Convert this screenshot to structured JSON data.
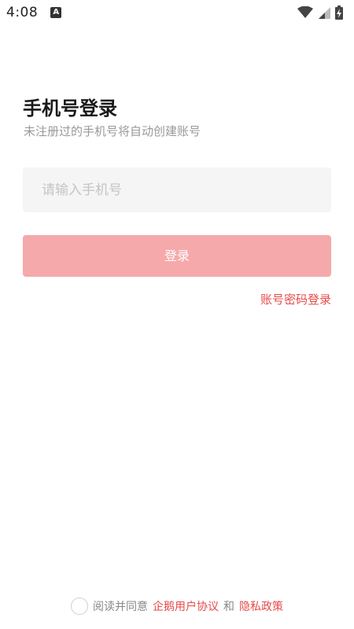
{
  "status_bar": {
    "time": "4:08",
    "notification_letter": "A",
    "icons": [
      "wifi-icon",
      "cellular-signal-icon",
      "battery-charging-icon"
    ]
  },
  "login": {
    "title": "手机号登录",
    "subtitle": "未注册过的手机号将自动创建账号",
    "phone_placeholder": "请输入手机号",
    "phone_value": "",
    "login_button": "登录",
    "password_login_link": "账号密码登录"
  },
  "agreement": {
    "checked": false,
    "prefix": "阅读并同意",
    "user_agreement": "企鹅用户协议",
    "and": "和",
    "privacy_policy": "隐私政策"
  },
  "colors": {
    "accent": "#e84a4a",
    "button_disabled": "#f5a9aa",
    "input_bg": "#f5f5f5",
    "muted_text": "#999999"
  }
}
